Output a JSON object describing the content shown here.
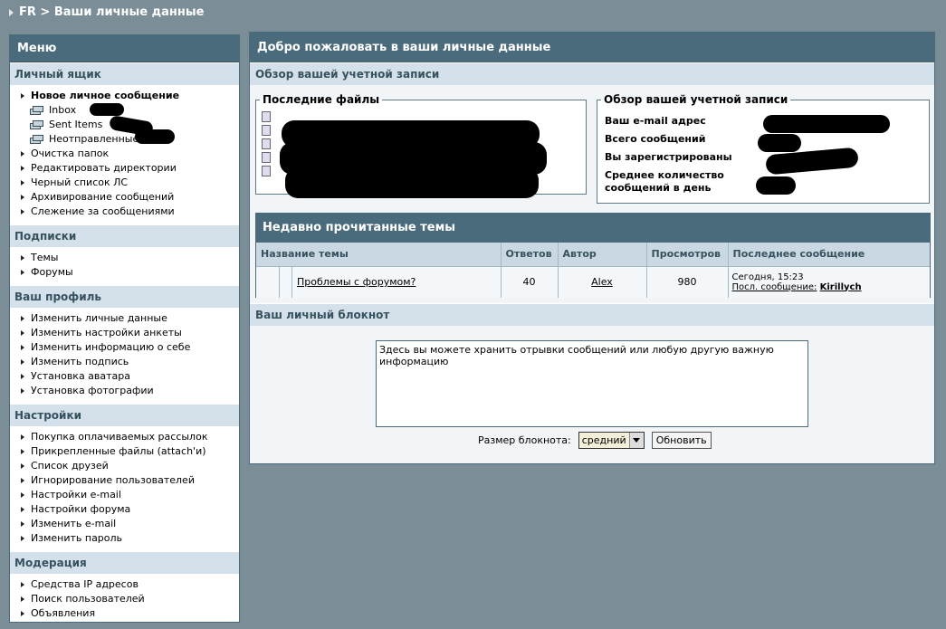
{
  "breadcrumb": "FR > Ваши личные данные",
  "sidebar": {
    "title": "Меню",
    "sections": [
      {
        "title": "Личный ящик",
        "items": [
          "Новое личное сообщение"
        ],
        "folders": [
          "Inbox",
          "Sent Items",
          "Неотправленные"
        ],
        "items_after": [
          "Очистка папок",
          "Редактировать директории",
          "Черный список ЛС",
          "Архивирование сообщений",
          "Слежение за сообщениями"
        ]
      },
      {
        "title": "Подписки",
        "items": [
          "Темы",
          "Форумы"
        ]
      },
      {
        "title": "Ваш профиль",
        "items": [
          "Изменить личные данные",
          "Изменить настройки анкеты",
          "Изменить информацию о себе",
          "Изменить подпись",
          "Установка аватара",
          "Установка фотографии"
        ]
      },
      {
        "title": "Настройки",
        "items": [
          "Покупка оплачиваемых рассылок",
          "Прикрепленные файлы (attach'и)",
          "Список друзей",
          "Игнорирование пользователей",
          "Настройки e-mail",
          "Настройки форума",
          "Изменить e-mail",
          "Изменить пароль"
        ]
      },
      {
        "title": "Модерация",
        "items": [
          "Средства IP адресов",
          "Поиск пользователей",
          "Объявления"
        ]
      }
    ]
  },
  "main": {
    "title": "Добро пожаловать в ваши личные данные",
    "overview_title": "Обзор вашей учетной записи",
    "files_legend": "Последние файлы",
    "account_legend": "Обзор вашей учетной записи",
    "account_rows": [
      "Ваш e-mail адрес",
      "Всего сообщений",
      "Вы зарегистрированы",
      "Среднее количество сообщений в день"
    ],
    "recent_title": "Недавно прочитанные темы",
    "table_headers": [
      "Название темы",
      "Ответов",
      "Автор",
      "Просмотров",
      "Последнее сообщение"
    ],
    "topic": {
      "title": "Проблемы с форумом?",
      "replies": "40",
      "author": "Alex",
      "views": "980",
      "last_date": "Сегодня, 15:23",
      "last_label": "Посл. сообщение:",
      "last_user": "Kirillych"
    },
    "notepad_title": "Ваш личный блокнот",
    "notepad_text": "Здесь вы можете хранить отрывки сообщений или любую другую важную информацию",
    "notepad_size_label": "Размер блокнота:",
    "notepad_size_value": "средний",
    "update_button": "Обновить"
  }
}
